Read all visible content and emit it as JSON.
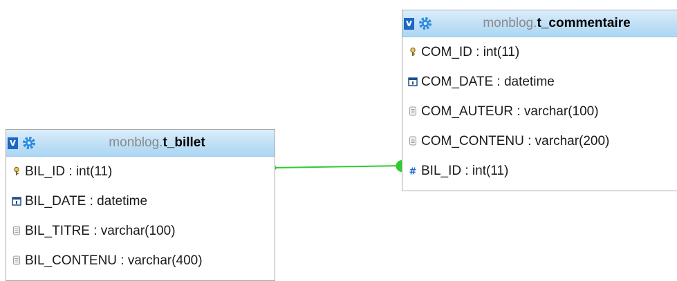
{
  "colors": {
    "header_top": "#dbeefb",
    "header_bottom": "#abd6f3",
    "toggle": "#1c67c7",
    "link": "#2ecc2e",
    "border": "#a9a9a9"
  },
  "tables": {
    "t_commentaire": {
      "toggle_label": "v",
      "gear_icon": "gear-icon",
      "database": "monblog.",
      "name": "t_commentaire",
      "columns": [
        {
          "icon": "primary-key-icon",
          "text": "COM_ID : int(11)"
        },
        {
          "icon": "date-column-icon",
          "text": "COM_DATE : datetime"
        },
        {
          "icon": "text-column-icon",
          "text": "COM_AUTEUR : varchar(100)"
        },
        {
          "icon": "text-column-icon",
          "text": "COM_CONTENU : varchar(200)"
        },
        {
          "icon": "numeric-column-icon",
          "text": "BIL_ID : int(11)"
        }
      ]
    },
    "t_billet": {
      "toggle_label": "v",
      "gear_icon": "gear-icon",
      "database": "monblog.",
      "name": "t_billet",
      "columns": [
        {
          "icon": "primary-key-icon",
          "text": "BIL_ID : int(11)"
        },
        {
          "icon": "date-column-icon",
          "text": "BIL_DATE : datetime"
        },
        {
          "icon": "text-column-icon",
          "text": "BIL_TITRE : varchar(100)"
        },
        {
          "icon": "text-column-icon",
          "text": "BIL_CONTENU : varchar(400)"
        }
      ]
    }
  },
  "relation": {
    "from": "t_billet.BIL_ID",
    "to": "t_commentaire.BIL_ID"
  }
}
